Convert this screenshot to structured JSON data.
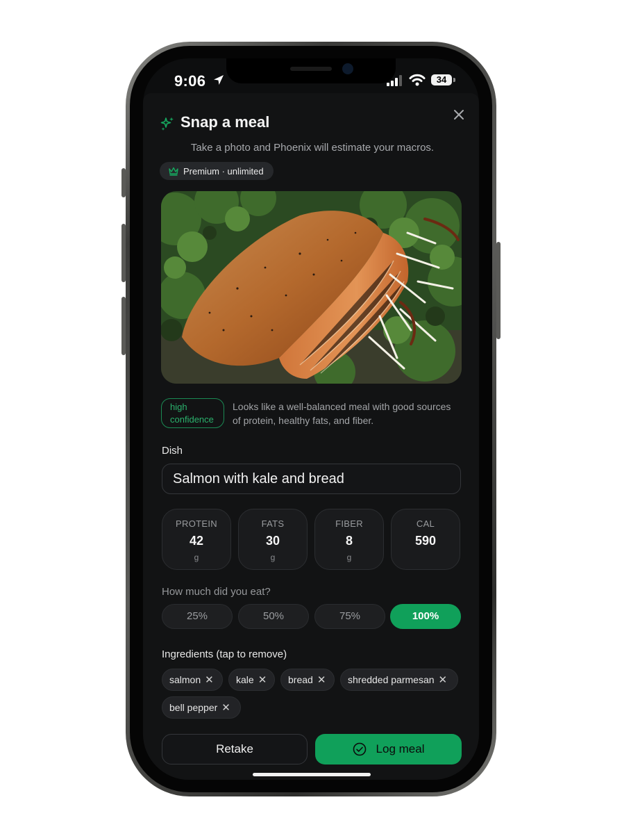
{
  "status_bar": {
    "time": "9:06",
    "battery": "34"
  },
  "header": {
    "title": "Snap a meal",
    "subtitle": "Take a photo and Phoenix will estimate your macros.",
    "badge": "Premium · unlimited"
  },
  "analysis": {
    "confidence_line1": "high",
    "confidence_line2": "confidence",
    "note_line1": "Looks like a well-balanced meal with good sources",
    "note_line2": "of protein, healthy fats, and fiber."
  },
  "dish": {
    "label": "Dish",
    "value": "Salmon with kale and bread"
  },
  "macros": [
    {
      "label": "PROTEIN",
      "value": "42",
      "unit": "g"
    },
    {
      "label": "FATS",
      "value": "30",
      "unit": "g"
    },
    {
      "label": "FIBER",
      "value": "8",
      "unit": "g"
    },
    {
      "label": "CAL",
      "value": "590",
      "unit": ""
    }
  ],
  "portion": {
    "label": "How much did you eat?",
    "options": [
      "25%",
      "50%",
      "75%",
      "100%"
    ],
    "selected": "100%"
  },
  "ingredients": {
    "label": "Ingredients (tap to remove)",
    "items": [
      "salmon",
      "kale",
      "bread",
      "shredded parmesan",
      "bell pepper"
    ]
  },
  "actions": {
    "retake": "Retake",
    "log": "Log meal"
  },
  "colors": {
    "accent": "#10a05a",
    "background": "#121314"
  },
  "icons": [
    "location-arrow-icon",
    "signal-icon",
    "wifi-icon",
    "battery-icon",
    "close-icon",
    "sparkle-icon",
    "crown-icon",
    "check-circle-icon"
  ]
}
